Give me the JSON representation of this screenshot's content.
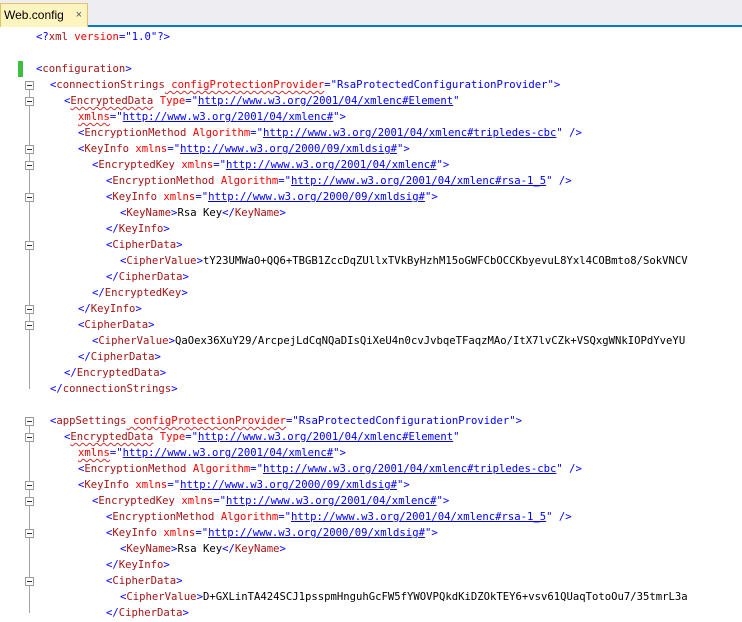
{
  "tab": {
    "title": "Web.config",
    "close_glyph": "×"
  },
  "colors": {
    "delimiter": "#0000ff",
    "tag": "#a31515",
    "attribute": "#ff0000",
    "value": "#0000ff",
    "text": "#000000",
    "modified_marker": "#3fbf3f"
  },
  "lines": [
    [
      [
        "d",
        "<?"
      ],
      [
        "t",
        "xml"
      ],
      [
        "a",
        " version"
      ],
      [
        "d",
        "=\""
      ],
      [
        "v",
        "1.0"
      ],
      [
        "d",
        "\"?>"
      ]
    ],
    [],
    [
      [
        "d",
        "<"
      ],
      [
        "t",
        "configuration"
      ],
      [
        "d",
        ">"
      ]
    ],
    [
      [
        "d",
        "<"
      ],
      [
        "t",
        "connectionStrings"
      ],
      [
        "a",
        " configProtectionProvider"
      ],
      [
        "d",
        "=\""
      ],
      [
        "v",
        "RsaProtectedConfigurationProvider"
      ],
      [
        "d",
        "\">"
      ]
    ],
    [
      [
        "d",
        "<"
      ],
      [
        "t",
        "EncryptedData"
      ],
      [
        "a",
        " Type"
      ],
      [
        "d",
        "=\""
      ],
      [
        "vu",
        "http://www.w3.org/2001/04/xmlenc#Element"
      ],
      [
        "d",
        "\""
      ]
    ],
    [
      [
        "a",
        "xmlns"
      ],
      [
        "d",
        "=\""
      ],
      [
        "vu",
        "http://www.w3.org/2001/04/xmlenc#"
      ],
      [
        "d",
        "\">"
      ]
    ],
    [
      [
        "d",
        "<"
      ],
      [
        "t",
        "EncryptionMethod"
      ],
      [
        "a",
        " Algorithm"
      ],
      [
        "d",
        "=\""
      ],
      [
        "vu",
        "http://www.w3.org/2001/04/xmlenc#tripledes-cbc"
      ],
      [
        "d",
        "\" />"
      ]
    ],
    [
      [
        "d",
        "<"
      ],
      [
        "t",
        "KeyInfo"
      ],
      [
        "a",
        " xmlns"
      ],
      [
        "d",
        "=\""
      ],
      [
        "vu",
        "http://www.w3.org/2000/09/xmldsig#"
      ],
      [
        "d",
        "\">"
      ]
    ],
    [
      [
        "d",
        "<"
      ],
      [
        "t",
        "EncryptedKey"
      ],
      [
        "a",
        " xmlns"
      ],
      [
        "d",
        "=\""
      ],
      [
        "vu",
        "http://www.w3.org/2001/04/xmlenc#"
      ],
      [
        "d",
        "\">"
      ]
    ],
    [
      [
        "d",
        "<"
      ],
      [
        "t",
        "EncryptionMethod"
      ],
      [
        "a",
        " Algorithm"
      ],
      [
        "d",
        "=\""
      ],
      [
        "vu",
        "http://www.w3.org/2001/04/xmlenc#rsa-1_5"
      ],
      [
        "d",
        "\" />"
      ]
    ],
    [
      [
        "d",
        "<"
      ],
      [
        "t",
        "KeyInfo"
      ],
      [
        "a",
        " xmlns"
      ],
      [
        "d",
        "=\""
      ],
      [
        "vu",
        "http://www.w3.org/2000/09/xmldsig#"
      ],
      [
        "d",
        "\">"
      ]
    ],
    [
      [
        "d",
        "<"
      ],
      [
        "t",
        "KeyName"
      ],
      [
        "d",
        ">"
      ],
      [
        "x",
        "Rsa Key"
      ],
      [
        "d",
        "</"
      ],
      [
        "t",
        "KeyName"
      ],
      [
        "d",
        ">"
      ]
    ],
    [
      [
        "d",
        "</"
      ],
      [
        "t",
        "KeyInfo"
      ],
      [
        "d",
        ">"
      ]
    ],
    [
      [
        "d",
        "<"
      ],
      [
        "t",
        "CipherData"
      ],
      [
        "d",
        ">"
      ]
    ],
    [
      [
        "d",
        "<"
      ],
      [
        "t",
        "CipherValue"
      ],
      [
        "d",
        ">"
      ],
      [
        "x",
        "tY23UMWaO+QQ6+TBGB1ZccDqZUllxTVkByHzhM15oGWFCbOCCKbyevuL8Yxl4COBmto8/SokVNCV"
      ]
    ],
    [
      [
        "d",
        "</"
      ],
      [
        "t",
        "CipherData"
      ],
      [
        "d",
        ">"
      ]
    ],
    [
      [
        "d",
        "</"
      ],
      [
        "t",
        "EncryptedKey"
      ],
      [
        "d",
        ">"
      ]
    ],
    [
      [
        "d",
        "</"
      ],
      [
        "t",
        "KeyInfo"
      ],
      [
        "d",
        ">"
      ]
    ],
    [
      [
        "d",
        "<"
      ],
      [
        "t",
        "CipherData"
      ],
      [
        "d",
        ">"
      ]
    ],
    [
      [
        "d",
        "<"
      ],
      [
        "t",
        "CipherValue"
      ],
      [
        "d",
        ">"
      ],
      [
        "x",
        "QaOex36XuY29/ArcpejLdCqNQaDIsQiXeU4n0cvJvbqeTFaqzMAo/ItX7lvCZk+VSQxgWNkIOPdYveYU"
      ]
    ],
    [
      [
        "d",
        "</"
      ],
      [
        "t",
        "CipherData"
      ],
      [
        "d",
        ">"
      ]
    ],
    [
      [
        "d",
        "</"
      ],
      [
        "t",
        "EncryptedData"
      ],
      [
        "d",
        ">"
      ]
    ],
    [
      [
        "d",
        "</"
      ],
      [
        "t",
        "connectionStrings"
      ],
      [
        "d",
        ">"
      ]
    ],
    [],
    [
      [
        "d",
        "<"
      ],
      [
        "t",
        "appSettings"
      ],
      [
        "a",
        " configProtectionProvider"
      ],
      [
        "d",
        "=\""
      ],
      [
        "v",
        "RsaProtectedConfigurationProvider"
      ],
      [
        "d",
        "\">"
      ]
    ],
    [
      [
        "d",
        "<"
      ],
      [
        "t",
        "EncryptedData"
      ],
      [
        "a",
        " Type"
      ],
      [
        "d",
        "=\""
      ],
      [
        "vu",
        "http://www.w3.org/2001/04/xmlenc#Element"
      ],
      [
        "d",
        "\""
      ]
    ],
    [
      [
        "a",
        "xmlns"
      ],
      [
        "d",
        "=\""
      ],
      [
        "vu",
        "http://www.w3.org/2001/04/xmlenc#"
      ],
      [
        "d",
        "\">"
      ]
    ],
    [
      [
        "d",
        "<"
      ],
      [
        "t",
        "EncryptionMethod"
      ],
      [
        "a",
        " Algorithm"
      ],
      [
        "d",
        "=\""
      ],
      [
        "vu",
        "http://www.w3.org/2001/04/xmlenc#tripledes-cbc"
      ],
      [
        "d",
        "\" />"
      ]
    ],
    [
      [
        "d",
        "<"
      ],
      [
        "t",
        "KeyInfo"
      ],
      [
        "a",
        " xmlns"
      ],
      [
        "d",
        "=\""
      ],
      [
        "vu",
        "http://www.w3.org/2000/09/xmldsig#"
      ],
      [
        "d",
        "\">"
      ]
    ],
    [
      [
        "d",
        "<"
      ],
      [
        "t",
        "EncryptedKey"
      ],
      [
        "a",
        " xmlns"
      ],
      [
        "d",
        "=\""
      ],
      [
        "vu",
        "http://www.w3.org/2001/04/xmlenc#"
      ],
      [
        "d",
        "\">"
      ]
    ],
    [
      [
        "d",
        "<"
      ],
      [
        "t",
        "EncryptionMethod"
      ],
      [
        "a",
        " Algorithm"
      ],
      [
        "d",
        "=\""
      ],
      [
        "vu",
        "http://www.w3.org/2001/04/xmlenc#rsa-1_5"
      ],
      [
        "d",
        "\" />"
      ]
    ],
    [
      [
        "d",
        "<"
      ],
      [
        "t",
        "KeyInfo"
      ],
      [
        "a",
        " xmlns"
      ],
      [
        "d",
        "=\""
      ],
      [
        "vu",
        "http://www.w3.org/2000/09/xmldsig#"
      ],
      [
        "d",
        "\">"
      ]
    ],
    [
      [
        "d",
        "<"
      ],
      [
        "t",
        "KeyName"
      ],
      [
        "d",
        ">"
      ],
      [
        "x",
        "Rsa Key"
      ],
      [
        "d",
        "</"
      ],
      [
        "t",
        "KeyName"
      ],
      [
        "d",
        ">"
      ]
    ],
    [
      [
        "d",
        "</"
      ],
      [
        "t",
        "KeyInfo"
      ],
      [
        "d",
        ">"
      ]
    ],
    [
      [
        "d",
        "<"
      ],
      [
        "t",
        "CipherData"
      ],
      [
        "d",
        ">"
      ]
    ],
    [
      [
        "d",
        "<"
      ],
      [
        "t",
        "CipherValue"
      ],
      [
        "d",
        ">"
      ],
      [
        "x",
        "D+GXLinTA424SCJ1psspmHnguhGcFW5fYWOVPQkdKiDZOkTEY6+vsv61QUaqTotoOu7/35tmrL3a"
      ]
    ],
    [
      [
        "d",
        "</"
      ],
      [
        "t",
        "CipherData"
      ],
      [
        "d",
        ">"
      ]
    ]
  ]
}
